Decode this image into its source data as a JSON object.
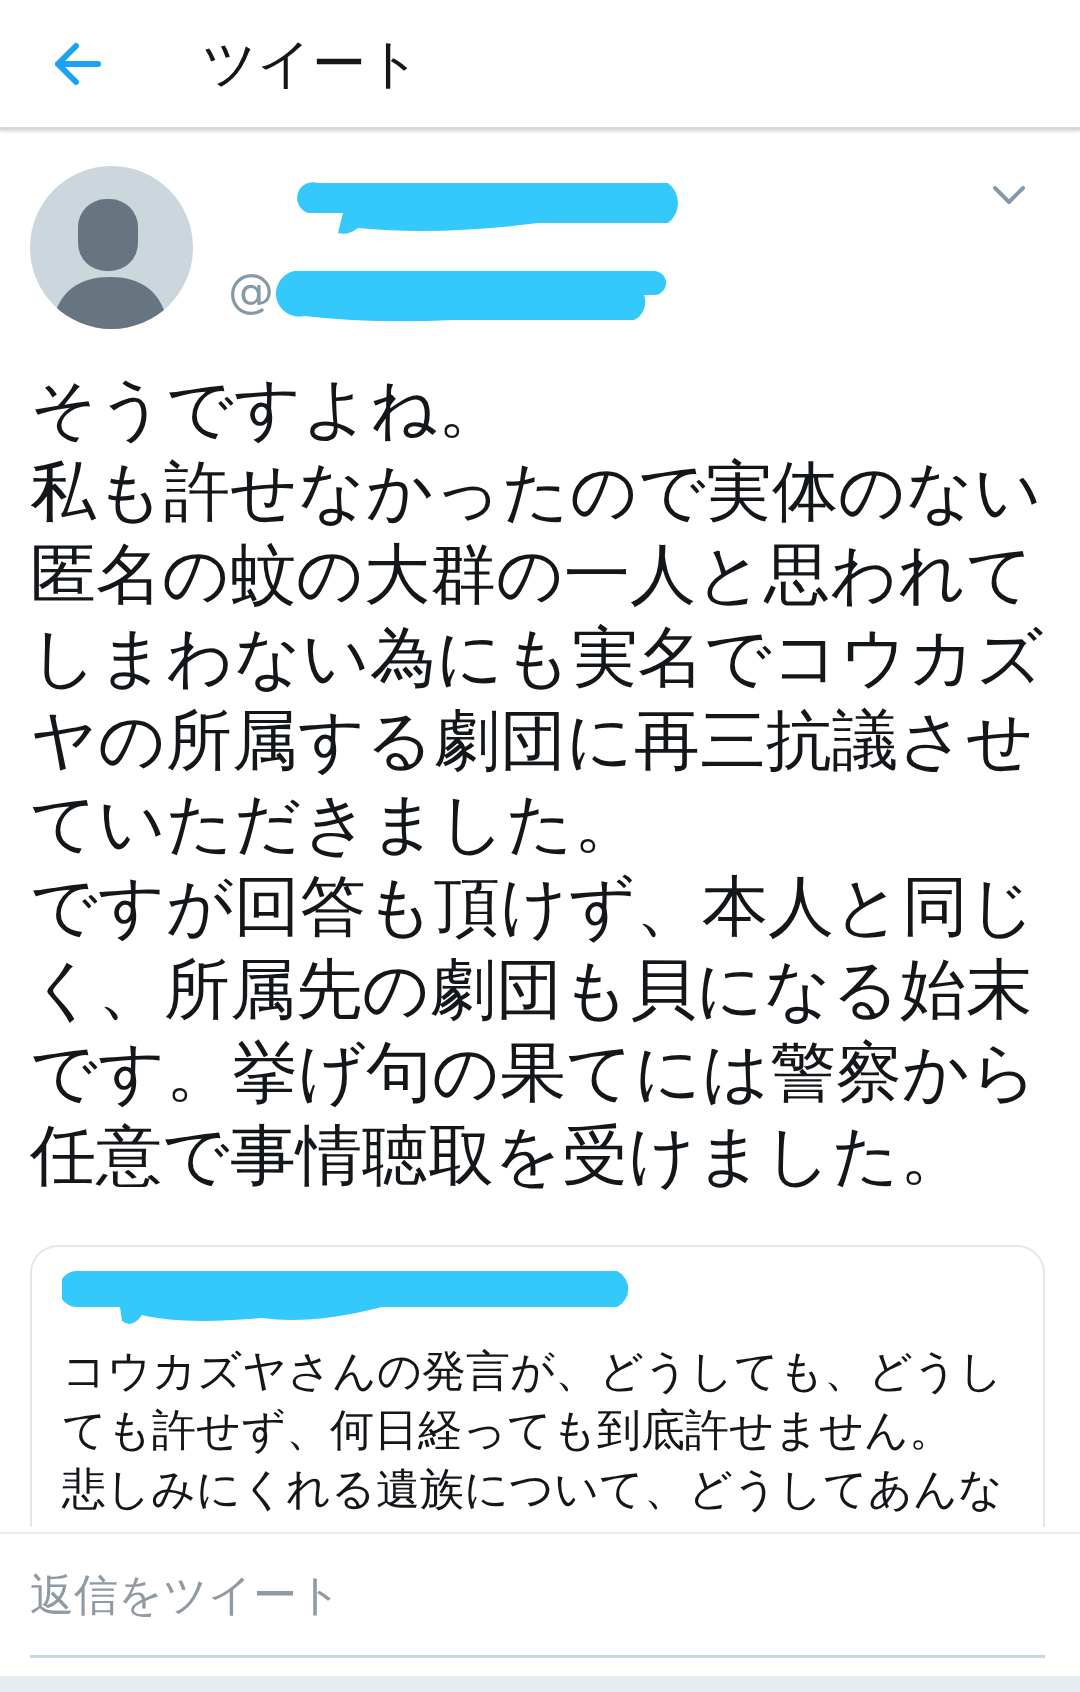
{
  "header": {
    "title": "ツイート"
  },
  "tweet": {
    "author": {
      "name_redacted": true,
      "handle_prefix": "@",
      "handle_redacted": true
    },
    "lines": [
      "そうですよね。",
      "私も許せなかったので実体のない",
      "匿名の蚊の大群の一人と思われて",
      "しまわない為にも実名でコウカズ",
      "ヤの所属する劇団に再三抗議させ",
      "ていただきました。",
      "ですが回答も頂けず、本人と同じ",
      "く、所属先の劇団も貝になる始末",
      "です。挙げ句の果てには警察から",
      "任意で事情聴取を受けました。"
    ],
    "quote": {
      "author_redacted": true,
      "lines": [
        "コウカズヤさんの発言が、どうしても、どうし",
        "ても許せず、何日経っても到底許せません。",
        "悲しみにくれる遺族について、どうしてあんな"
      ]
    }
  },
  "reply_bar": {
    "placeholder": "返信をツイート"
  }
}
